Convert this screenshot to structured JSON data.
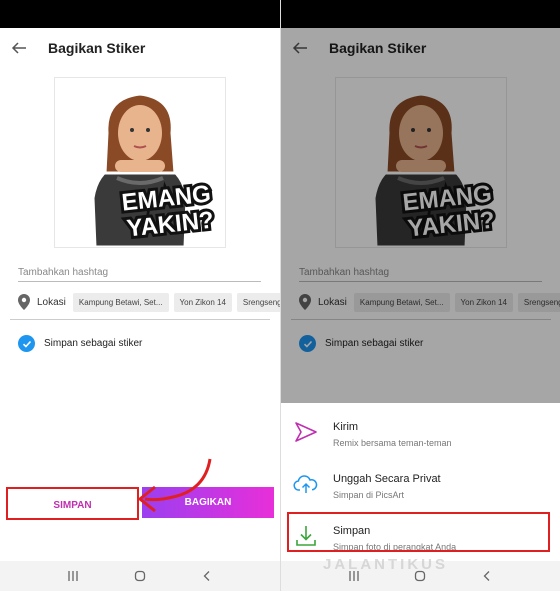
{
  "screen": {
    "title": "Bagikan Stiker",
    "sticker_text_line1": "EMANG",
    "sticker_text_line2": "YAKIN?",
    "hashtag_placeholder": "Tambahkan hashtag",
    "location_label": "Lokasi",
    "location_chips": [
      "Kampung Betawi, Set...",
      "Yon Zikon 14",
      "Srengseng"
    ],
    "save_as_sticker": "Simpan sebagai stiker",
    "btn_save": "SIMPAN",
    "btn_share": "BAGIKAN"
  },
  "sheet": {
    "items": [
      {
        "title": "Kirim",
        "subtitle": "Remix bersama teman-teman",
        "icon": "send-icon"
      },
      {
        "title": "Unggah Secara Privat",
        "subtitle": "Simpan di PicsArt",
        "icon": "cloud-upload-icon"
      },
      {
        "title": "Simpan",
        "subtitle": "Simpan foto di perangkat Anda",
        "icon": "download-icon"
      }
    ]
  },
  "watermark": "JALANTIKUS",
  "colors": {
    "accent_blue": "#1e96f0",
    "accent_pink": "#c02fb0",
    "gradient_start": "#9b3ff0",
    "gradient_end": "#e82fd9",
    "highlight_red": "#e02020"
  }
}
